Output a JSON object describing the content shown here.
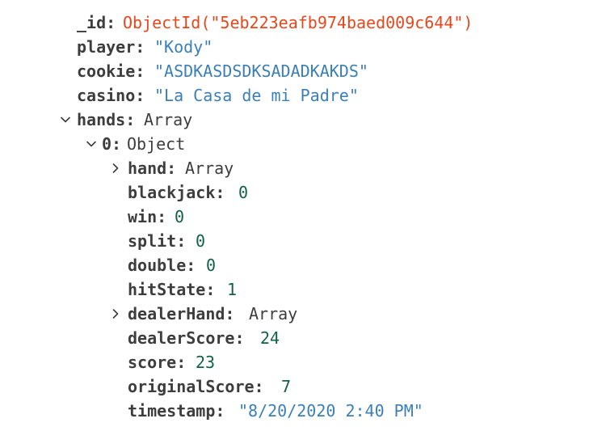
{
  "document": {
    "fields": [
      {
        "key": "_id",
        "value": "ObjectId(\"5eb223eafb974baed009c644\")",
        "type": "oid"
      },
      {
        "key": "player",
        "value": "\"Kody\"",
        "type": "string"
      },
      {
        "key": "cookie",
        "value": "\"ASDKASDSDKSADADKAKDS\"",
        "type": "string"
      },
      {
        "key": "casino",
        "value": "\"La Casa de mi Padre\"",
        "type": "string"
      },
      {
        "key": "hands",
        "value": "Array",
        "type": "type",
        "toggle": "expanded"
      },
      {
        "key": "0",
        "value": "Object",
        "type": "type",
        "toggle": "expanded"
      },
      {
        "key": "hand",
        "value": "Array",
        "type": "type",
        "toggle": "collapsed"
      },
      {
        "key": "blackjack",
        "value": "0",
        "type": "number"
      },
      {
        "key": "win",
        "value": "0",
        "type": "number"
      },
      {
        "key": "split",
        "value": "0",
        "type": "number"
      },
      {
        "key": "double",
        "value": "0",
        "type": "number"
      },
      {
        "key": "hitState",
        "value": "1",
        "type": "number"
      },
      {
        "key": "dealerHand",
        "value": "Array",
        "type": "type",
        "toggle": "collapsed"
      },
      {
        "key": "dealerScore",
        "value": "24",
        "type": "number"
      },
      {
        "key": "score",
        "value": "23",
        "type": "number"
      },
      {
        "key": "originalScore",
        "value": "7",
        "type": "number"
      },
      {
        "key": "timestamp",
        "value": "\"8/20/2020 2:40 PM\"",
        "type": "string"
      }
    ]
  },
  "colors": {
    "key": "#3d3d3d",
    "string": "#3b7fb8",
    "number": "#116149",
    "objectid": "#e6471c"
  },
  "icons": {
    "expanded": "chevron-down-icon",
    "collapsed": "chevron-right-icon"
  }
}
